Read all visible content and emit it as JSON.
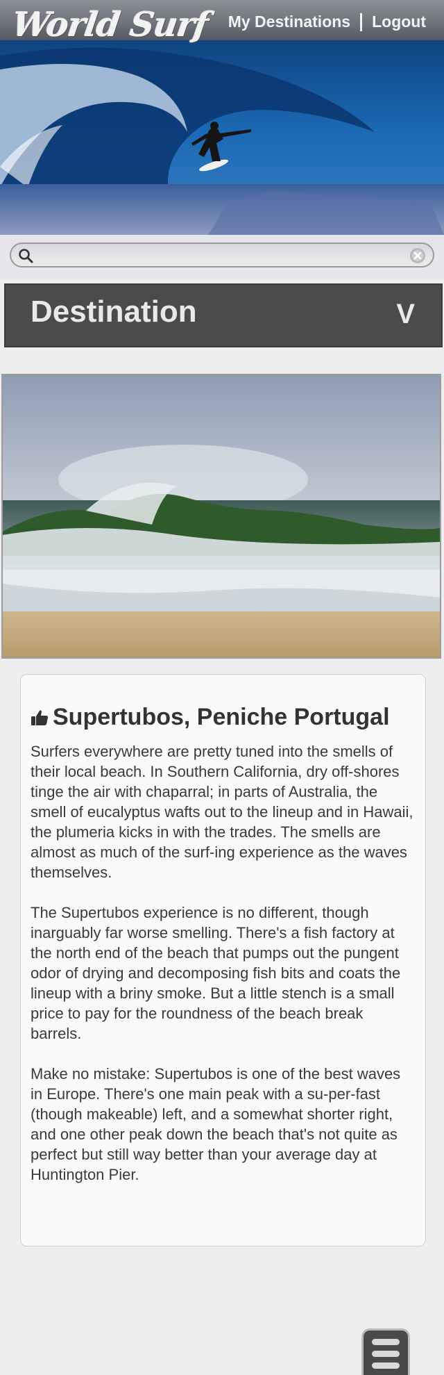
{
  "header": {
    "logo_text": "World Surf",
    "nav": {
      "my_destinations": "My Destinations",
      "logout": "Logout"
    }
  },
  "search": {
    "value": "",
    "placeholder": ""
  },
  "destination_bar": {
    "title": "Destination",
    "toggle": "V"
  },
  "spot": {
    "title": "Supertubos, Peniche Portugal",
    "paragraphs": [
      "Surfers everywhere are pretty tuned into the smells of their local beach. In Southern California, dry off-shores tinge the air with chaparral; in parts of Australia, the smell of eucalyptus wafts out to the lineup and in Hawaii, the plumeria kicks in with the trades. The smells are almost as much of the surf-ing experience as the waves themselves.",
      "The Supertubos experience is no different, though inarguably far worse smelling. There's a fish factory at the north end of the beach that pumps out the pungent odor of drying and decomposing fish bits and coats the lineup with a briny smoke. But a little stench is a small price to pay for the roundness of the beach break barrels.",
      "Make no mistake: Supertubos is one of the best waves in Europe. There's one main peak with a su-per-fast (though makeable) left, and a somewhat shorter right, and one other peak down the beach that's not quite as perfect but still way better than your average day at Huntington Pier."
    ]
  },
  "icons": {
    "search": "search-icon",
    "clear": "clear-icon",
    "thumb": "thumbs-up-icon",
    "menu": "menu-icon"
  },
  "colors": {
    "header_bar": "#4b4b4d",
    "page_bg": "#eeeef1",
    "nav_text": "#f4f4f4"
  }
}
